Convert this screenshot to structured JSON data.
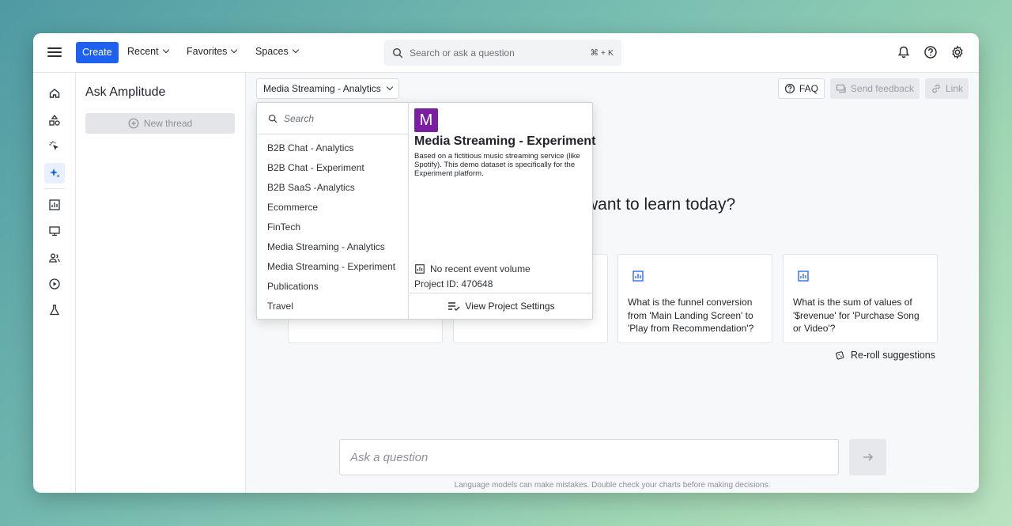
{
  "nav": {
    "create_label": "Create",
    "recent_label": "Recent",
    "favorites_label": "Favorites",
    "spaces_label": "Spaces",
    "search_placeholder": "Search or ask a question",
    "search_shortcut": "⌘ + K"
  },
  "threads": {
    "title": "Ask Amplitude",
    "new_thread_label": "New thread"
  },
  "project": {
    "selected": "Media Streaming - Analytics"
  },
  "actions": {
    "faq_label": "FAQ",
    "feedback_label": "Send feedback",
    "link_label": "Link"
  },
  "main": {
    "hero_fragment": "want to learn today?",
    "suggestions": [
      "",
      "",
      "What is the funnel conversion from 'Main Landing Screen' to 'Play from Recommendation'?",
      "What is the sum of values of '$revenue' for 'Purchase Song or Video'?"
    ],
    "reroll_label": "Re-roll suggestions",
    "ask_placeholder": "Ask a question",
    "disclaimer": "Language models can make mistakes. Double check your charts before making decisions."
  },
  "dropdown": {
    "search_placeholder": "Search",
    "items": [
      "B2B Chat - Analytics",
      "B2B Chat - Experiment",
      "B2B SaaS -Analytics",
      "Ecommerce",
      "FinTech",
      "Media Streaming - Analytics",
      "Media Streaming - Experiment",
      "Publications",
      "Travel"
    ],
    "preview": {
      "avatar_letter": "M",
      "avatar_color": "#7b1fa2",
      "title": "Media Streaming - Experiment",
      "description": "Based on a fictitious music streaming service (like Spotify). This demo dataset is specifically for the Experiment platform.",
      "event_volume": "No recent event volume",
      "project_id": "Project ID: 470648",
      "settings_label": "View Project Settings"
    }
  },
  "colors": {
    "accent": "#1e61f0",
    "active_rail_bg": "#e8efff"
  }
}
